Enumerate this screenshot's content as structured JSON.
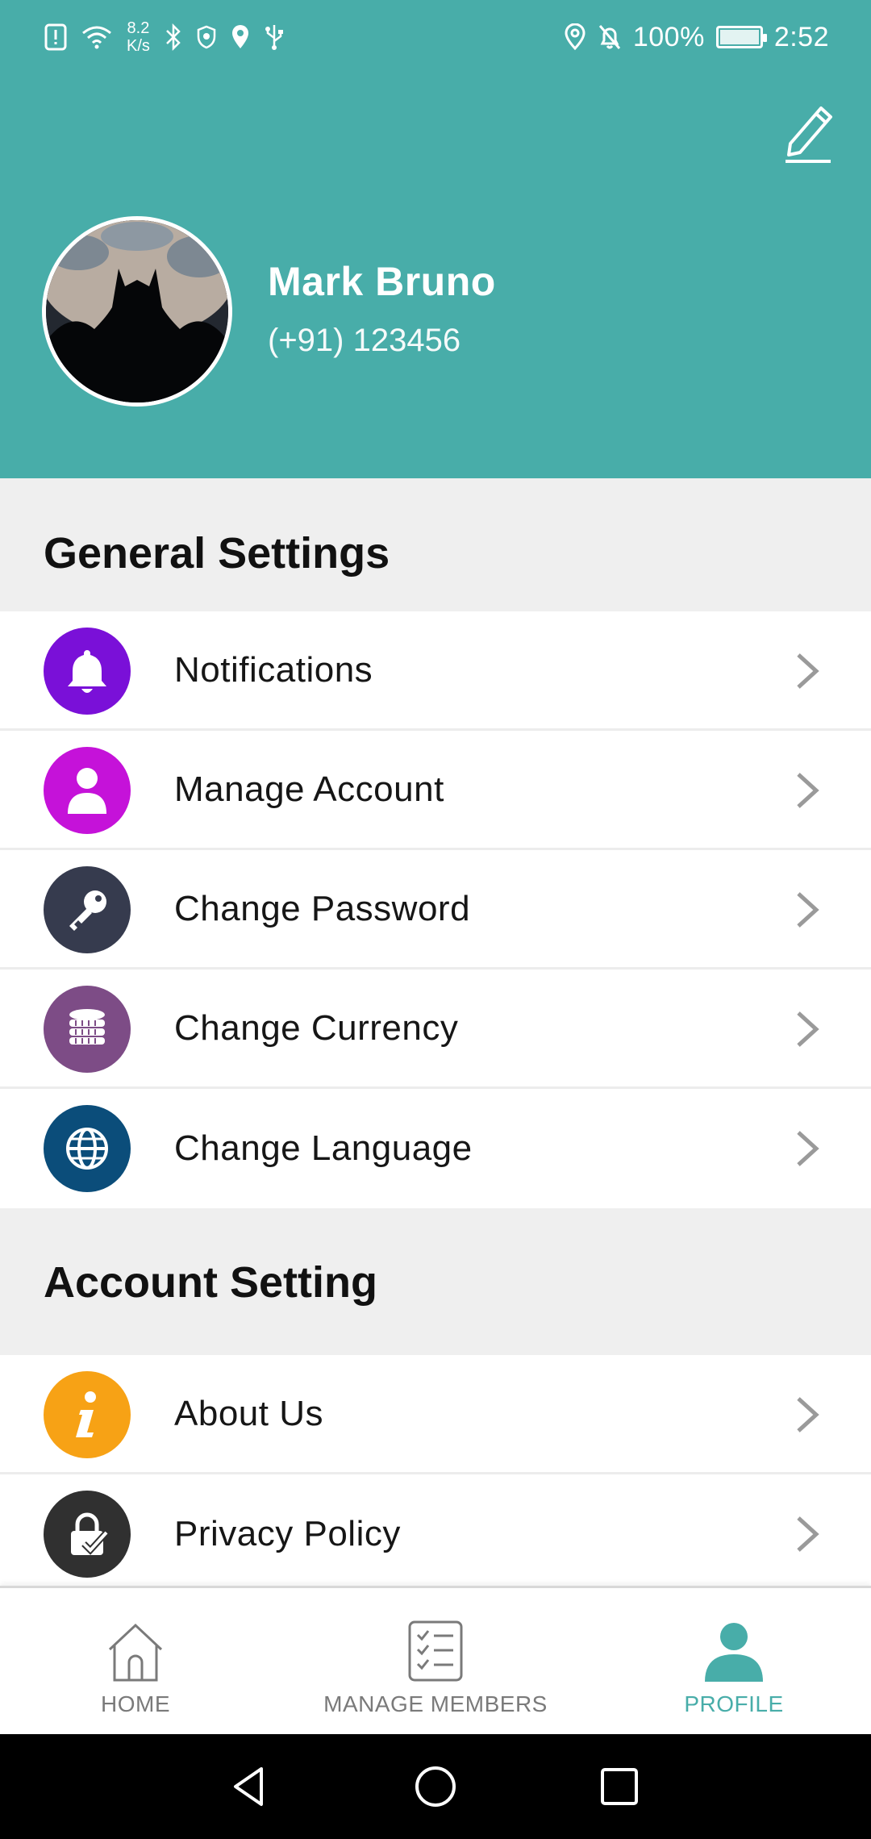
{
  "status_bar": {
    "net_speed_value": "8.2",
    "net_speed_unit": "K/s",
    "battery": "100%",
    "time": "2:52"
  },
  "profile": {
    "name": "Mark Bruno",
    "phone": "(+91) 123456"
  },
  "general_settings": {
    "title": "General Settings",
    "items": [
      {
        "label": "Notifications",
        "icon": "bell-icon",
        "color": "#7a10d8"
      },
      {
        "label": "Manage Account",
        "icon": "user-icon",
        "color": "#c512d9"
      },
      {
        "label": "Change Password",
        "icon": "key-icon",
        "color": "#363b4e"
      },
      {
        "label": "Change Currency",
        "icon": "coins-icon",
        "color": "#7d4c86"
      },
      {
        "label": "Change Language",
        "icon": "globe-icon",
        "color": "#0b4d7a"
      }
    ]
  },
  "account_settings": {
    "title": "Account Setting",
    "items": [
      {
        "label": "About Us",
        "icon": "info-icon",
        "color": "#f7a215"
      },
      {
        "label": "Privacy Policy",
        "icon": "lock-check-icon",
        "color": "#303030"
      }
    ]
  },
  "bottom_nav": {
    "items": [
      {
        "label": "HOME",
        "icon": "home-icon",
        "active": false
      },
      {
        "label": "MANAGE MEMBERS",
        "icon": "checklist-icon",
        "active": false
      },
      {
        "label": "PROFILE",
        "icon": "person-icon",
        "active": true
      }
    ],
    "active_color": "#48ada9"
  },
  "colors": {
    "header": "#48ada9",
    "background": "#efefef"
  }
}
